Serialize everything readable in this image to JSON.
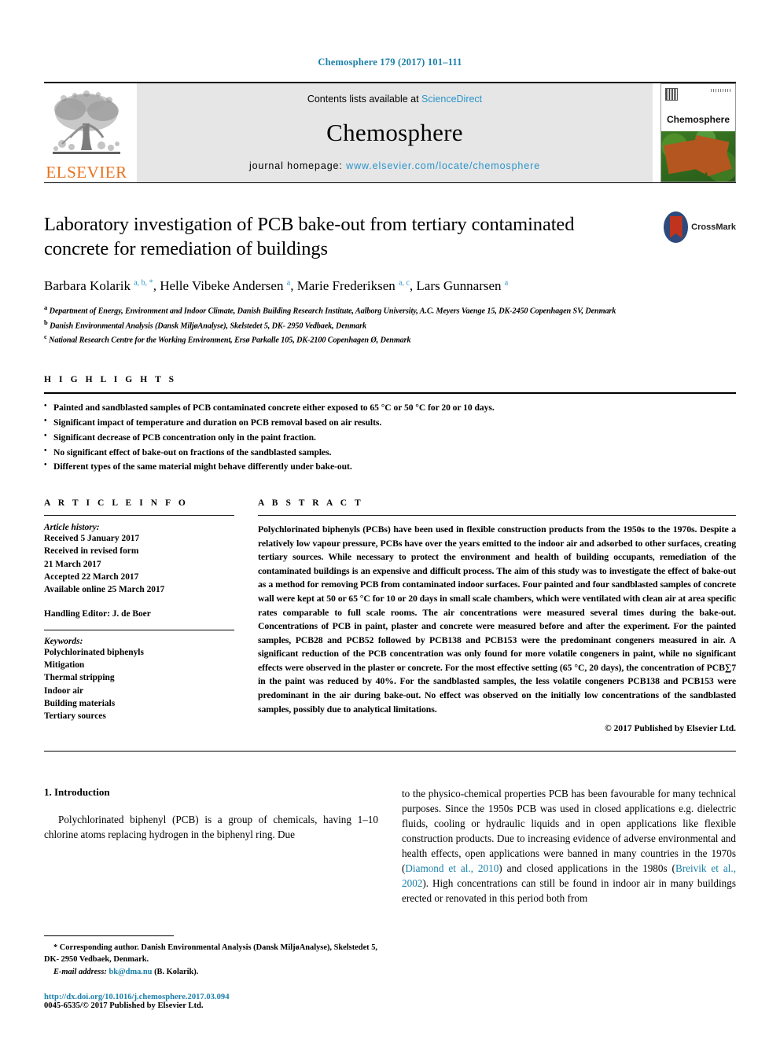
{
  "running_head": "Chemosphere 179 (2017) 101–111",
  "masthead": {
    "publisher_logo_label": "ELSEVIER",
    "contents_prefix": "Contents lists available at ",
    "contents_link": "ScienceDirect",
    "journal_title": "Chemosphere",
    "homepage_prefix": "journal homepage: ",
    "homepage_link": "www.elsevier.com/locate/chemosphere",
    "cover_title": "Chemosphere"
  },
  "article": {
    "title": "Laboratory investigation of PCB bake-out from tertiary contaminated concrete for remediation of buildings",
    "crossmark_label": "CrossMark",
    "authors": [
      {
        "name": "Barbara Kolarik",
        "marks": "a, b, *"
      },
      {
        "name": "Helle Vibeke Andersen",
        "marks": "a"
      },
      {
        "name": "Marie Frederiksen",
        "marks": "a, c"
      },
      {
        "name": "Lars Gunnarsen",
        "marks": "a"
      }
    ],
    "affiliations": [
      {
        "mark": "a",
        "text": "Department of Energy, Environment and Indoor Climate, Danish Building Research Institute, Aalborg University, A.C. Meyers Vaenge 15, DK-2450 Copenhagen SV, Denmark"
      },
      {
        "mark": "b",
        "text": "Danish Environmental Analysis (Dansk MiljøAnalyse), Skelstedet 5, DK- 2950 Vedbaek, Denmark"
      },
      {
        "mark": "c",
        "text": "National Research Centre for the Working Environment, Ersø Parkalle 105, DK-2100 Copenhagen Ø, Denmark"
      }
    ]
  },
  "highlights": {
    "heading": "H I G H L I G H T S",
    "items": [
      "Painted and sandblasted samples of PCB contaminated concrete either exposed to 65 °C or 50 °C for 20 or 10 days.",
      "Significant impact of temperature and duration on PCB removal based on air results.",
      "Significant decrease of PCB concentration only in the paint fraction.",
      "No significant effect of bake-out on fractions of the sandblasted samples.",
      "Different types of the same material might behave differently under bake-out."
    ]
  },
  "article_info": {
    "heading": "A R T I C L E   I N F O",
    "history_label": "Article history:",
    "history_lines": [
      "Received 5 January 2017",
      "Received in revised form",
      "21 March 2017",
      "Accepted 22 March 2017",
      "Available online 25 March 2017"
    ],
    "handling_editor": "Handling Editor: J. de Boer",
    "keywords_label": "Keywords:",
    "keywords": [
      "Polychlorinated biphenyls",
      "Mitigation",
      "Thermal stripping",
      "Indoor air",
      "Building materials",
      "Tertiary sources"
    ]
  },
  "abstract": {
    "heading": "A B S T R A C T",
    "text": "Polychlorinated biphenyls (PCBs) have been used in flexible construction products from the 1950s to the 1970s. Despite a relatively low vapour pressure, PCBs have over the years emitted to the indoor air and adsorbed to other surfaces, creating tertiary sources. While necessary to protect the environment and health of building occupants, remediation of the contaminated buildings is an expensive and difficult process. The aim of this study was to investigate the effect of bake-out as a method for removing PCB from contaminated indoor surfaces. Four painted and four sandblasted samples of concrete wall were kept at 50 or 65 °C for 10 or 20 days in small scale chambers, which were ventilated with clean air at area specific rates comparable to full scale rooms. The air concentrations were measured several times during the bake-out. Concentrations of PCB in paint, plaster and concrete were measured before and after the experiment. For the painted samples, PCB28 and PCB52 followed by PCB138 and PCB153 were the predominant congeners measured in air. A significant reduction of the PCB concentration was only found for more volatile congeners in paint, while no significant effects were observed in the plaster or concrete. For the most effective setting (65 °C, 20 days), the concentration of PCB∑7 in the paint was reduced by 40%. For the sandblasted samples, the less volatile congeners PCB138 and PCB153 were predominant in the air during bake-out. No effect was observed on the initially low concentrations of the sandblasted samples, possibly due to analytical limitations.",
    "copyright": "© 2017 Published by Elsevier Ltd."
  },
  "introduction": {
    "heading": "1. Introduction",
    "left_paragraph": "Polychlorinated biphenyl (PCB) is a group of chemicals, having 1–10 chlorine atoms replacing hydrogen in the biphenyl ring. Due",
    "right_paragraph_part1": "to the physico-chemical properties PCB has been favourable for many technical purposes. Since the 1950s PCB was used in closed applications e.g. dielectric fluids, cooling or hydraulic liquids and in open applications like flexible construction products. Due to increasing evidence of adverse environmental and health effects, open applications were banned in many countries in the 1970s (",
    "citation1": "Diamond et al., 2010",
    "right_paragraph_part2": ") and closed applications in the 1980s (",
    "citation2": "Breivik et al., 2002",
    "right_paragraph_part3": "). High concentrations can still be found in indoor air in many buildings erected or renovated in this period both from"
  },
  "footnote": {
    "corresponding_text": "* Corresponding author. Danish Environmental Analysis (Dansk MiljøAnalyse), Skelstedet 5, DK- 2950 Vedbaek, Denmark.",
    "email_label": "E-mail address:",
    "email": "bk@dma.nu",
    "email_owner": "(B. Kolarik).",
    "doi": "http://dx.doi.org/10.1016/j.chemosphere.2017.03.094",
    "issn_copyright": "0045-6535/© 2017 Published by Elsevier Ltd."
  }
}
